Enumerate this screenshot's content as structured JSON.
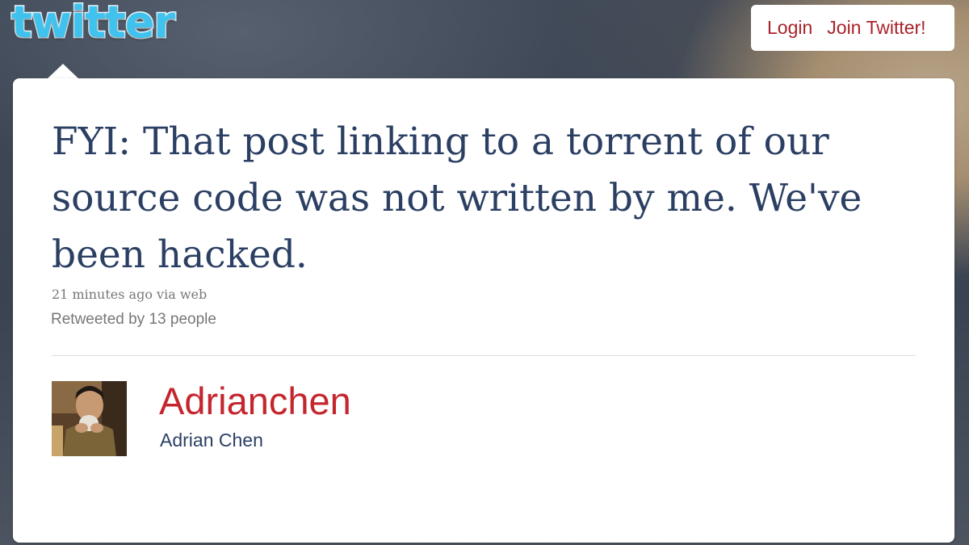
{
  "header": {
    "logo_text": "twitter",
    "login_label": "Login",
    "join_label": "Join Twitter!"
  },
  "tweet": {
    "text": "FYI: That post linking to a torrent of our source code was not written by me. We've been hacked.",
    "meta": "21 minutes ago via web",
    "retweets": "Retweeted by 13 people"
  },
  "author": {
    "screen_name": "Adrianchen",
    "full_name": "Adrian Chen"
  },
  "colors": {
    "link_red": "#c4262e",
    "text_navy": "#2b3f63",
    "logo_blue": "#3fc3ee"
  }
}
